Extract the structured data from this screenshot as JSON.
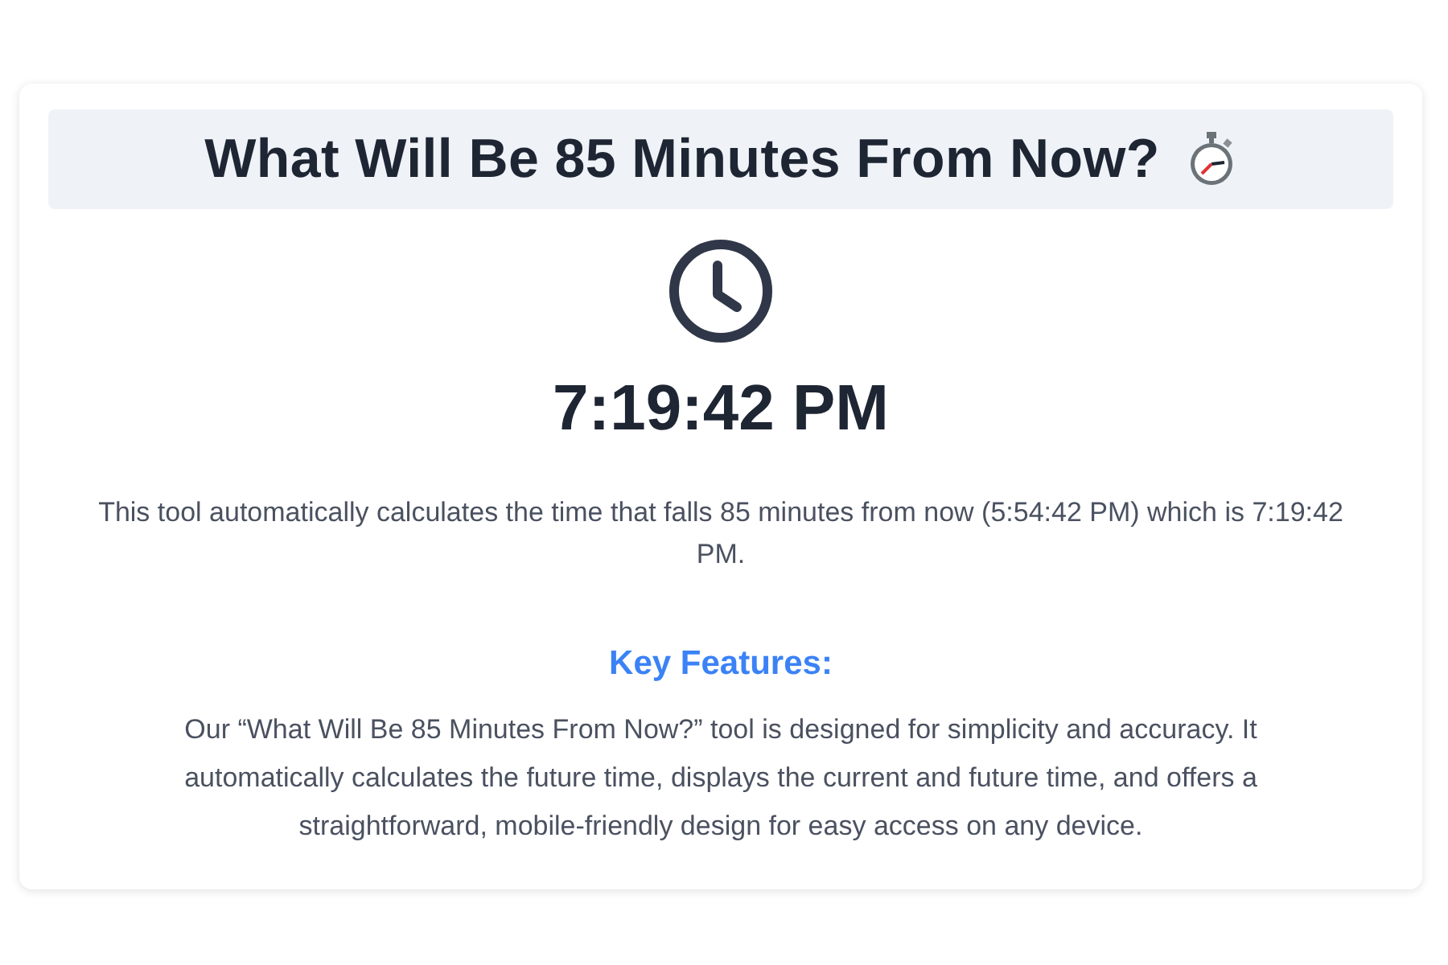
{
  "title": "What Will Be 85 Minutes From Now?",
  "result_time": "7:19:42 PM",
  "description": "This tool automatically calculates the time that falls 85 minutes from now (5:54:42 PM) which is 7:19:42 PM.",
  "features": {
    "heading": "Key Features:",
    "text": "Our “What Will Be 85 Minutes From Now?” tool is designed for simplicity and accuracy. It automatically calculates the future time, displays the current and future time, and offers a straightforward, mobile-friendly design for easy access on any device."
  }
}
